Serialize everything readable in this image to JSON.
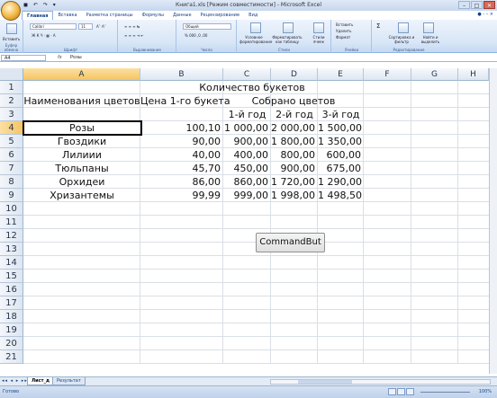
{
  "window": {
    "title": "Книга1.xls [Режим совместимости] - Microsoft Excel",
    "quick_access": "◼ ↶ ↷ ▾",
    "controls": {
      "minimize": "–",
      "restore": "□",
      "close": "✕"
    }
  },
  "ribbon": {
    "tabs": [
      "Главная",
      "Вставка",
      "Разметка страницы",
      "Формулы",
      "Данные",
      "Рецензирование",
      "Вид"
    ],
    "active_tab": 0,
    "help": "● - – ×",
    "groups": {
      "clipboard": {
        "label": "Буфер обмена",
        "paste": "Вставить"
      },
      "font": {
        "label": "Шрифт",
        "font_name": "Calibri",
        "font_size": "11",
        "row1": "A˄ A˅",
        "row2": "Ж К Ч · ▦ · A"
      },
      "alignment": {
        "label": "Выравнивание",
        "row1": "≡ ≡ ≡ ↹",
        "row2": "≡ ≡ ≡ ⇥ ⇤"
      },
      "number": {
        "label": "Число",
        "format": "Общий",
        "row2": "% 000 ,0 ,00"
      },
      "styles": {
        "label": "Стили",
        "cond": "Условное форматирование",
        "table": "Форматировать как таблицу",
        "cell": "Стили ячеек"
      },
      "cells": {
        "label": "Ячейки",
        "insert": "Вставить",
        "delete": "Удалить",
        "format": "Формат"
      },
      "editing": {
        "label": "Редактирование",
        "sigma": "Σ",
        "sort": "Сортировка и фильтр",
        "find": "Найти и выделить"
      }
    }
  },
  "formula_bar": {
    "name_box": "A4",
    "fx": "fx",
    "value": "Розы"
  },
  "grid": {
    "columns": [
      "A",
      "B",
      "C",
      "D",
      "E",
      "F",
      "G",
      "H"
    ],
    "rows": [
      "1",
      "2",
      "3",
      "4",
      "5",
      "6",
      "7",
      "8",
      "9",
      "10",
      "11",
      "12",
      "13",
      "14",
      "15",
      "16",
      "17",
      "18",
      "19",
      "20",
      "21"
    ],
    "selected_column": "A",
    "selected_row": "4",
    "header_title": "Количество букетов",
    "col_a_header": "Наименования цветов",
    "col_b_header": "Цена 1-го букета",
    "collected_header": "Собрано цветов",
    "years": [
      "1-й год",
      "2-й год",
      "3-й год"
    ],
    "data": [
      [
        "Розы",
        "100,10",
        "1 000,00",
        "2 000,00",
        "1 500,00"
      ],
      [
        "Гвоздики",
        "90,00",
        "900,00",
        "1 800,00",
        "1 350,00"
      ],
      [
        "Лилиии",
        "40,00",
        "400,00",
        "800,00",
        "600,00"
      ],
      [
        "Тюльпаны",
        "45,70",
        "450,00",
        "900,00",
        "675,00"
      ],
      [
        "Орхидеи",
        "86,00",
        "860,00",
        "1 720,00",
        "1 290,00"
      ],
      [
        "Хризантемы",
        "99,99",
        "999,00",
        "1 998,00",
        "1 498,50"
      ]
    ]
  },
  "command_button": "CommandBut",
  "sheets": {
    "nav": "◂◂ ◂ ▸ ▸▸",
    "tabs": [
      "Лист_д",
      "Результат"
    ],
    "active": 0
  },
  "status": {
    "ready": "Готово",
    "zoom": "100%"
  }
}
